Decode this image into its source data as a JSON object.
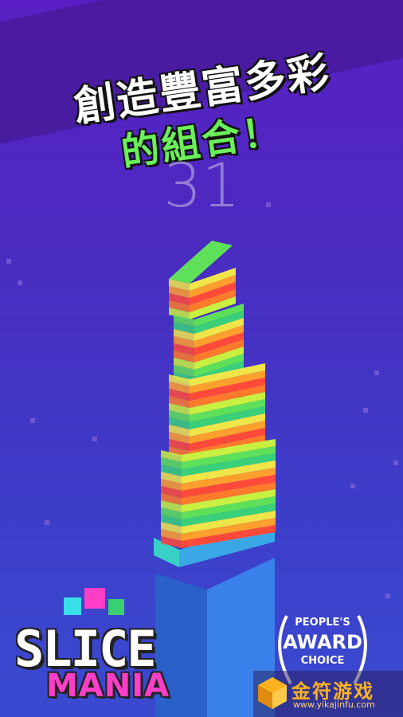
{
  "banner": {
    "line1": "創造豐富多彩",
    "line2": "的組合！"
  },
  "score": "31",
  "logo": {
    "word1": "SLICE",
    "word2": "MANIA"
  },
  "award": {
    "line1": "PEOPLE'S",
    "line2": "AWARD",
    "line3": "CHOICE"
  },
  "watermark": {
    "brand": "金符游戏",
    "url": "www.yikajinfu.com"
  },
  "colors": {
    "stripes": [
      "#f0e64a",
      "#ff9f2e",
      "#ff4a3a",
      "#ff7a2a",
      "#c8f040",
      "#5ee05a",
      "#3ad07a"
    ],
    "base_top": "#3ad0c8",
    "base_body": "#2f7ae0"
  }
}
